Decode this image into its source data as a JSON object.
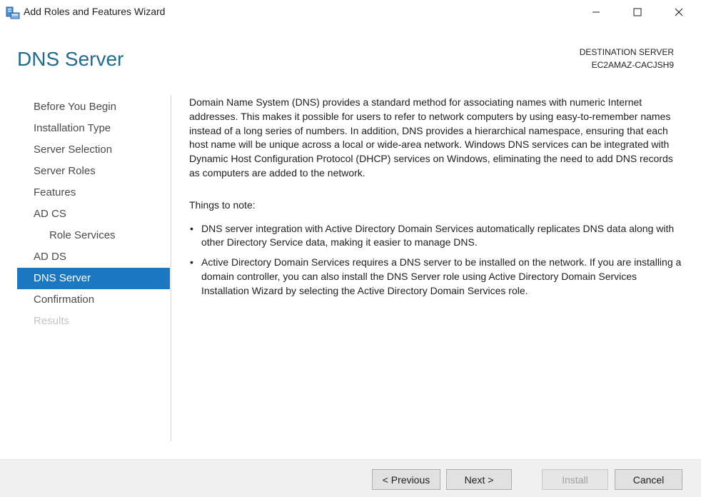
{
  "window": {
    "title": "Add Roles and Features Wizard",
    "icon": "server-manager-icon"
  },
  "header": {
    "page_title": "DNS Server",
    "destination_label": "DESTINATION SERVER",
    "destination_server": "EC2AMAZ-CACJSH9"
  },
  "nav": {
    "items": [
      {
        "label": "Before You Begin",
        "state": "normal"
      },
      {
        "label": "Installation Type",
        "state": "normal"
      },
      {
        "label": "Server Selection",
        "state": "normal"
      },
      {
        "label": "Server Roles",
        "state": "normal"
      },
      {
        "label": "Features",
        "state": "normal"
      },
      {
        "label": "AD CS",
        "state": "normal"
      },
      {
        "label": "Role Services",
        "state": "sub"
      },
      {
        "label": "AD DS",
        "state": "normal"
      },
      {
        "label": "DNS Server",
        "state": "active"
      },
      {
        "label": "Confirmation",
        "state": "normal"
      },
      {
        "label": "Results",
        "state": "disabled"
      }
    ]
  },
  "content": {
    "intro": "Domain Name System (DNS) provides a standard method for associating names with numeric Internet addresses. This makes it possible for users to refer to network computers by using easy-to-remember names instead of a long series of numbers. In addition, DNS provides a hierarchical namespace, ensuring that each host name will be unique across a local or wide-area network. Windows DNS services can be integrated with Dynamic Host Configuration Protocol (DHCP) services on Windows, eliminating the need to add DNS records as computers are added to the network.",
    "things_title": "Things to note:",
    "bullet_symbol": "•",
    "bullets": [
      "DNS server integration with Active Directory Domain Services automatically replicates DNS data along with other Directory Service data, making it easier to manage DNS.",
      "Active Directory Domain Services requires a DNS server to be installed on the network. If you are installing a domain controller, you can also install the DNS Server role using Active Directory Domain Services Installation Wizard by selecting the Active Directory Domain Services role."
    ]
  },
  "footer": {
    "previous_label": "< Previous",
    "next_label": "Next >",
    "install_label": "Install",
    "cancel_label": "Cancel"
  },
  "colors": {
    "title_blue": "#236b8e",
    "active_nav_bg": "#1c78c0",
    "disabled_text": "#c4c4c4"
  }
}
